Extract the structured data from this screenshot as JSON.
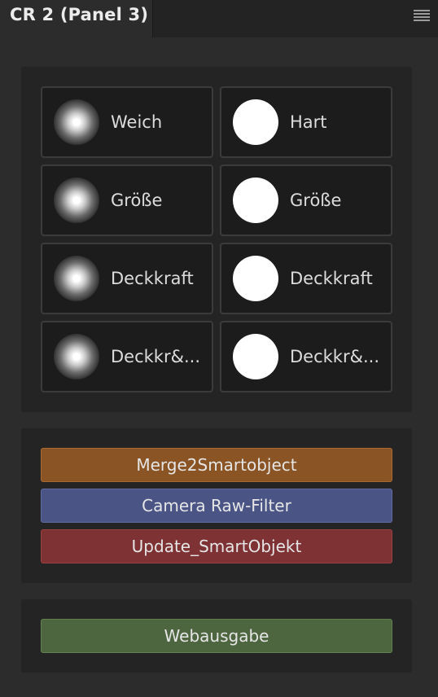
{
  "panel": {
    "tab_title": "CR 2 (Panel 3)",
    "menu_icon": "hamburger-menu-icon"
  },
  "brushes": [
    {
      "label": "Weich",
      "style": "soft"
    },
    {
      "label": "Hart",
      "style": "hard"
    },
    {
      "label": "Größe",
      "style": "soft"
    },
    {
      "label": "Größe",
      "style": "hard"
    },
    {
      "label": "Deckkraft",
      "style": "soft"
    },
    {
      "label": "Deckkraft",
      "style": "hard"
    },
    {
      "label": "Deckkr&...",
      "style": "soft"
    },
    {
      "label": "Deckkr&...",
      "style": "hard"
    }
  ],
  "actions": {
    "merge": {
      "label": "Merge2Smartobject",
      "color": "#8a5424"
    },
    "camera": {
      "label": "Camera Raw-Filter",
      "color": "#4a5586"
    },
    "update": {
      "label": "Update_SmartObjekt",
      "color": "#7e3234"
    }
  },
  "export": {
    "web": {
      "label": "Webausgabe",
      "color": "#4e6640"
    }
  }
}
